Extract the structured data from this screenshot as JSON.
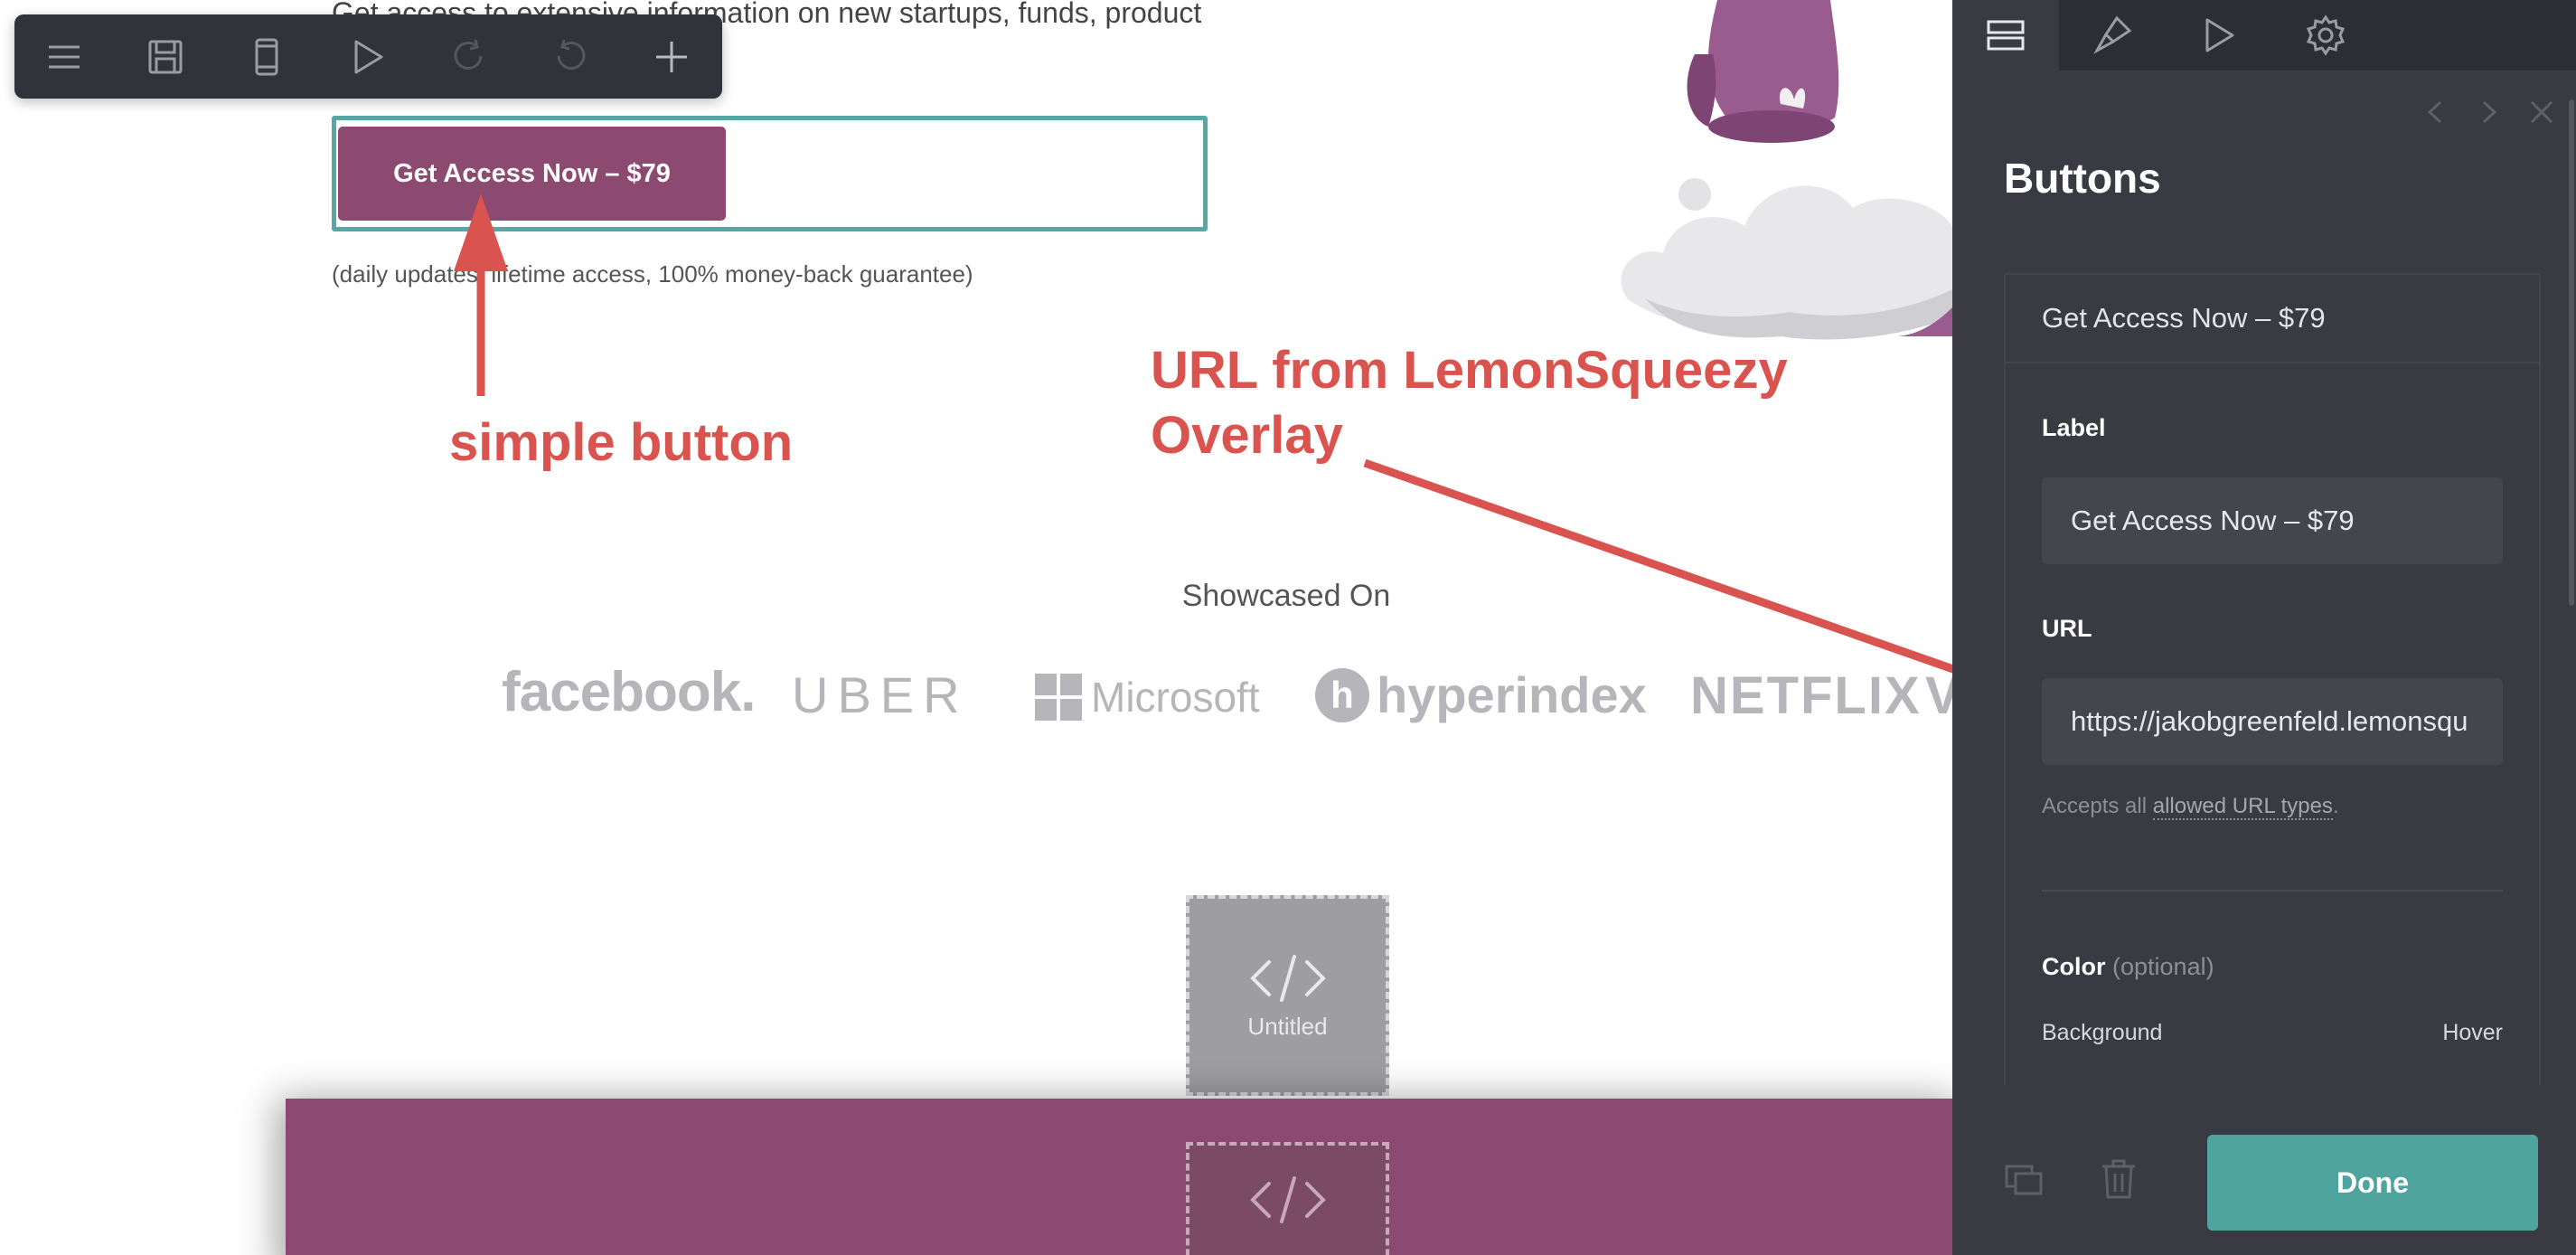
{
  "canvas": {
    "intro_text": "Get access to extensive information on new startups, funds, product",
    "cta_button_label": "Get Access Now – $79",
    "cta_subtext": "(daily updates, lifetime access, 100% money-back guarantee)",
    "showcase_heading": "Showcased On",
    "logos": {
      "facebook": "facebook.",
      "uber": "UBER",
      "microsoft": "Microsoft",
      "hyperindex_mark": "h",
      "hyperindex": "hyperindex",
      "netflix": "NETFLIX",
      "partial": "V"
    },
    "embed_title": "Untitled"
  },
  "annotations": {
    "simple_button": "simple button",
    "url_note_line1": "URL from LemonSqueezy",
    "url_note_line2": "Overlay"
  },
  "toolbar": {
    "items": [
      "menu-icon",
      "save-icon",
      "mobile-preview-icon",
      "play-icon",
      "redo-icon",
      "undo-icon",
      "add-icon"
    ]
  },
  "panel": {
    "tabs": [
      "layout-icon",
      "brush-icon",
      "play-icon",
      "gear-icon"
    ],
    "title": "Buttons",
    "item_header": "Get Access Now – $79",
    "label_field": {
      "label": "Label",
      "value": "Get Access Now – $79"
    },
    "url_field": {
      "label": "URL",
      "value": "https://jakobgreenfeld.lemonsqu",
      "help_prefix": "Accepts all ",
      "help_link": "allowed URL types",
      "help_suffix": "."
    },
    "color_section": {
      "label": "Color",
      "optional": "(optional)",
      "background": "Background",
      "hover": "Hover"
    },
    "done_label": "Done"
  },
  "colors": {
    "accent_purple": "#8c4a71",
    "accent_teal": "#4fa59e",
    "annotation_red": "#d9534f",
    "panel_bg": "#393a42"
  }
}
